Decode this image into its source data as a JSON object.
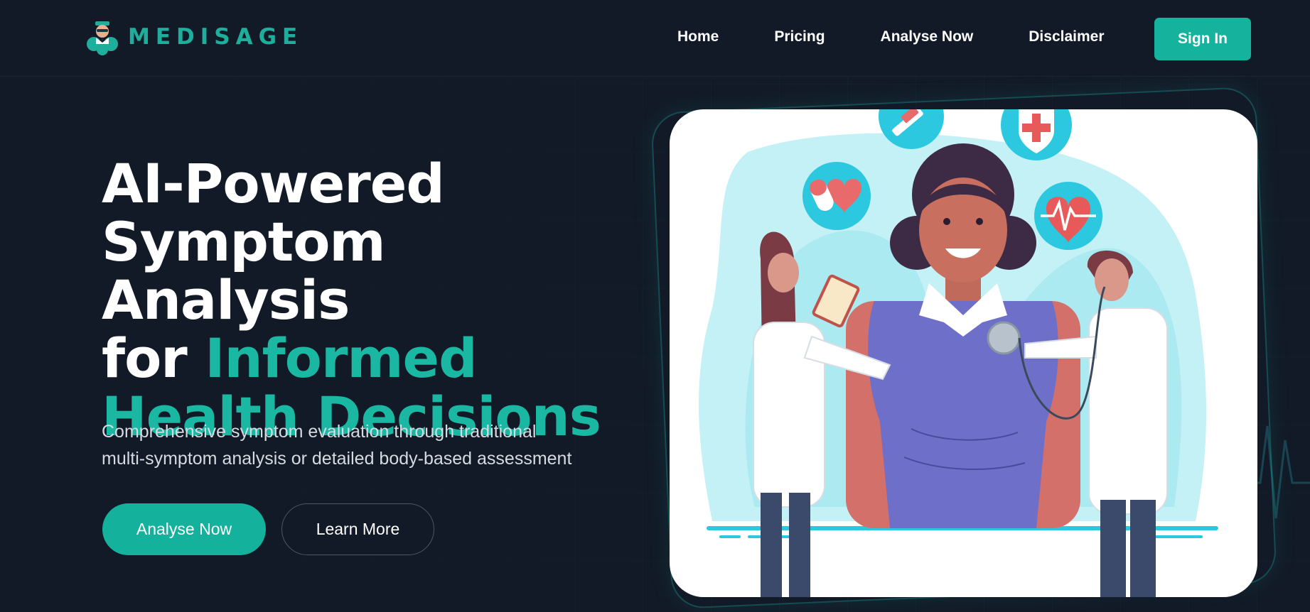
{
  "brand": {
    "name": "MEDISAGE",
    "accent_color": "#1fae9c"
  },
  "nav": {
    "links": [
      {
        "label": "Home"
      },
      {
        "label": "Pricing"
      },
      {
        "label": "Analyse Now"
      },
      {
        "label": "Disclaimer"
      }
    ],
    "sign_in_label": "Sign In"
  },
  "hero": {
    "title_line1": "AI-Powered",
    "title_line2": "Symptom Analysis",
    "title_line3_plain": "for ",
    "title_line3_accent": "Informed",
    "title_line4_accent": "Health Decisions",
    "subtitle_line1": "Comprehensive symptom evaluation through traditional",
    "subtitle_line2": "multi-symptom analysis or detailed body-based assessment",
    "primary_button": "Analyse Now",
    "secondary_button": "Learn More"
  },
  "illustration": {
    "icons": [
      "syringe-icon",
      "medical-shield-icon",
      "pills-heart-icon",
      "heartbeat-icon"
    ]
  },
  "colors": {
    "background": "#121a27",
    "primary": "#14b29c",
    "text": "#ffffff",
    "muted_text": "#d6dbe2"
  }
}
